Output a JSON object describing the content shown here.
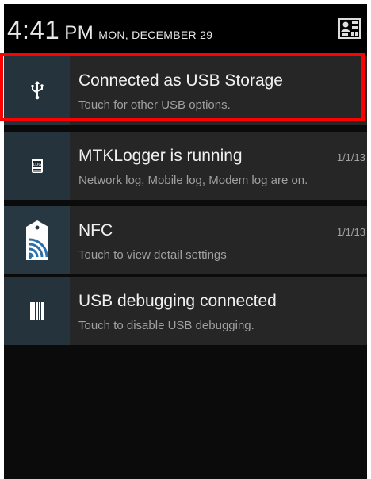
{
  "status": {
    "time": "4:41",
    "ampm": "PM",
    "date": "MON, DECEMBER 29"
  },
  "notifications": [
    {
      "icon": "usb-icon",
      "title": "Connected as USB Storage",
      "subtitle": "Touch for other USB options.",
      "time": ""
    },
    {
      "icon": "log-icon",
      "title": "MTKLogger is running",
      "subtitle": "Network log, Mobile log, Modem log are on.",
      "time": "1/1/13"
    },
    {
      "icon": "nfc-icon",
      "title": "NFC",
      "subtitle": "Touch to view detail settings",
      "time": "1/1/13"
    },
    {
      "icon": "usb-debugging-icon",
      "title": "USB debugging connected",
      "subtitle": "Touch to disable USB debugging.",
      "time": ""
    }
  ],
  "colors": {
    "highlight": "#ff0000",
    "icon_bg": "#24333c",
    "card_bg": "#262626"
  }
}
